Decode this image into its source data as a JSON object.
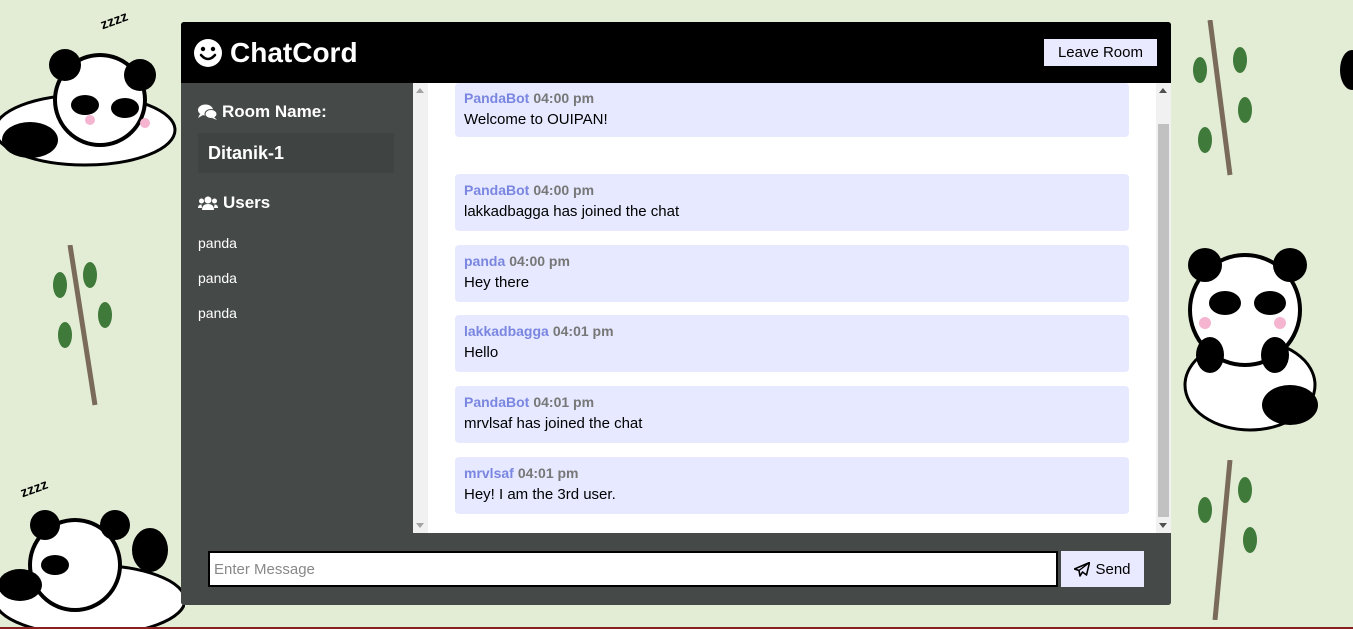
{
  "header": {
    "title": "ChatCord",
    "brand_icon": "smile-icon",
    "leave_label": "Leave Room"
  },
  "sidebar": {
    "room_heading": "Room Name:",
    "room_icon": "comments-icon",
    "room_name": "Ditanik-1",
    "users_heading": "Users",
    "users_icon": "users-icon",
    "users": [
      "panda",
      "panda",
      "panda"
    ]
  },
  "messages": [
    {
      "user": "PandaBot",
      "time": "04:00 pm",
      "text": "Welcome to OUIPAN!"
    },
    {
      "user": "PandaBot",
      "time": "04:00 pm",
      "text": "lakkadbagga has joined the chat"
    },
    {
      "user": "panda",
      "time": "04:00 pm",
      "text": "Hey there"
    },
    {
      "user": "lakkadbagga",
      "time": "04:01 pm",
      "text": "Hello"
    },
    {
      "user": "PandaBot",
      "time": "04:01 pm",
      "text": "mrvlsaf has joined the chat"
    },
    {
      "user": "mrvlsaf",
      "time": "04:01 pm",
      "text": "Hey! I am the 3rd user."
    }
  ],
  "form": {
    "placeholder": "Enter Message",
    "value": "",
    "send_label": "Send",
    "send_icon": "paper-plane-icon"
  },
  "colors": {
    "header_bg": "#000000",
    "panel_bg": "#454a48",
    "message_bg": "#e6e9ff",
    "username": "#7a86e0",
    "button_bg": "#e9eaff"
  }
}
